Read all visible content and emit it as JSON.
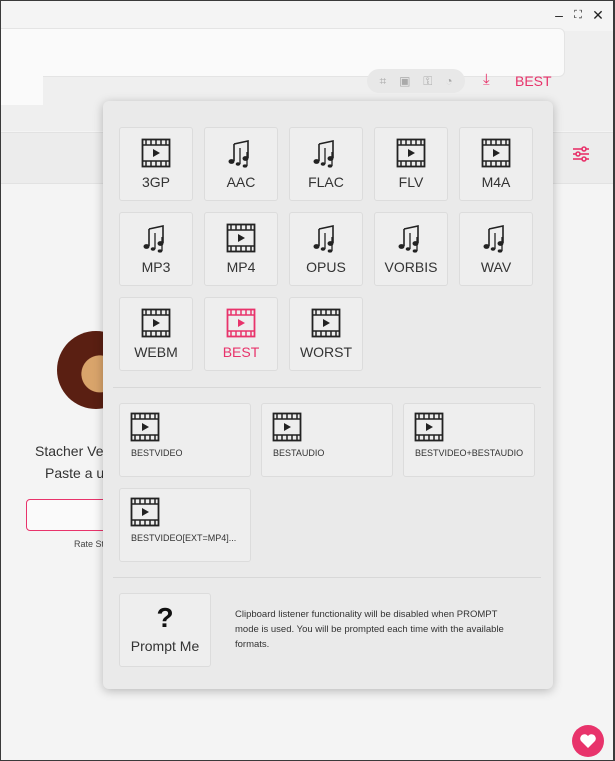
{
  "window": {
    "controls": {
      "minimize": "‒",
      "maximize": "⛶",
      "close": "✕"
    }
  },
  "search": {
    "input_value": "",
    "format_label": "BEST",
    "toolbar_icons": [
      "crop-icon",
      "save-icon",
      "key-icon",
      "cookie-icon"
    ]
  },
  "background": {
    "app_line": "Stacher Ver",
    "paste_line": "Paste a ur",
    "rate_text": "Rate St"
  },
  "format_picker": {
    "formats": [
      {
        "id": "3gp",
        "label": "3GP",
        "kind": "video"
      },
      {
        "id": "aac",
        "label": "AAC",
        "kind": "audio"
      },
      {
        "id": "flac",
        "label": "FLAC",
        "kind": "audio"
      },
      {
        "id": "flv",
        "label": "FLV",
        "kind": "video"
      },
      {
        "id": "m4a",
        "label": "M4A",
        "kind": "video"
      },
      {
        "id": "mp3",
        "label": "MP3",
        "kind": "audio"
      },
      {
        "id": "mp4",
        "label": "MP4",
        "kind": "video"
      },
      {
        "id": "opus",
        "label": "OPUS",
        "kind": "audio"
      },
      {
        "id": "vorbis",
        "label": "VORBIS",
        "kind": "audio"
      },
      {
        "id": "wav",
        "label": "WAV",
        "kind": "audio"
      },
      {
        "id": "webm",
        "label": "WEBM",
        "kind": "video"
      },
      {
        "id": "best",
        "label": "BEST",
        "kind": "video",
        "selected": true
      },
      {
        "id": "worst",
        "label": "WORST",
        "kind": "video"
      }
    ],
    "combos": [
      {
        "id": "bestvideo",
        "label": "BESTVIDEO"
      },
      {
        "id": "bestaudio",
        "label": "BESTAUDIO"
      },
      {
        "id": "bestvideo-bestaudio",
        "label": "BESTVIDEO+BESTAUDIO"
      },
      {
        "id": "bestvideo-ext-mp4",
        "label": "BESTVIDEO[EXT=MP4]..."
      }
    ],
    "prompt": {
      "symbol": "?",
      "label": "Prompt Me",
      "note": "Clipboard listener functionality will be disabled when PROMPT mode is used. You will be prompted each time with the available formats."
    }
  },
  "colors": {
    "accent": "#e8336b",
    "panel": "#eaeaea",
    "tile": "#eeeeee"
  }
}
